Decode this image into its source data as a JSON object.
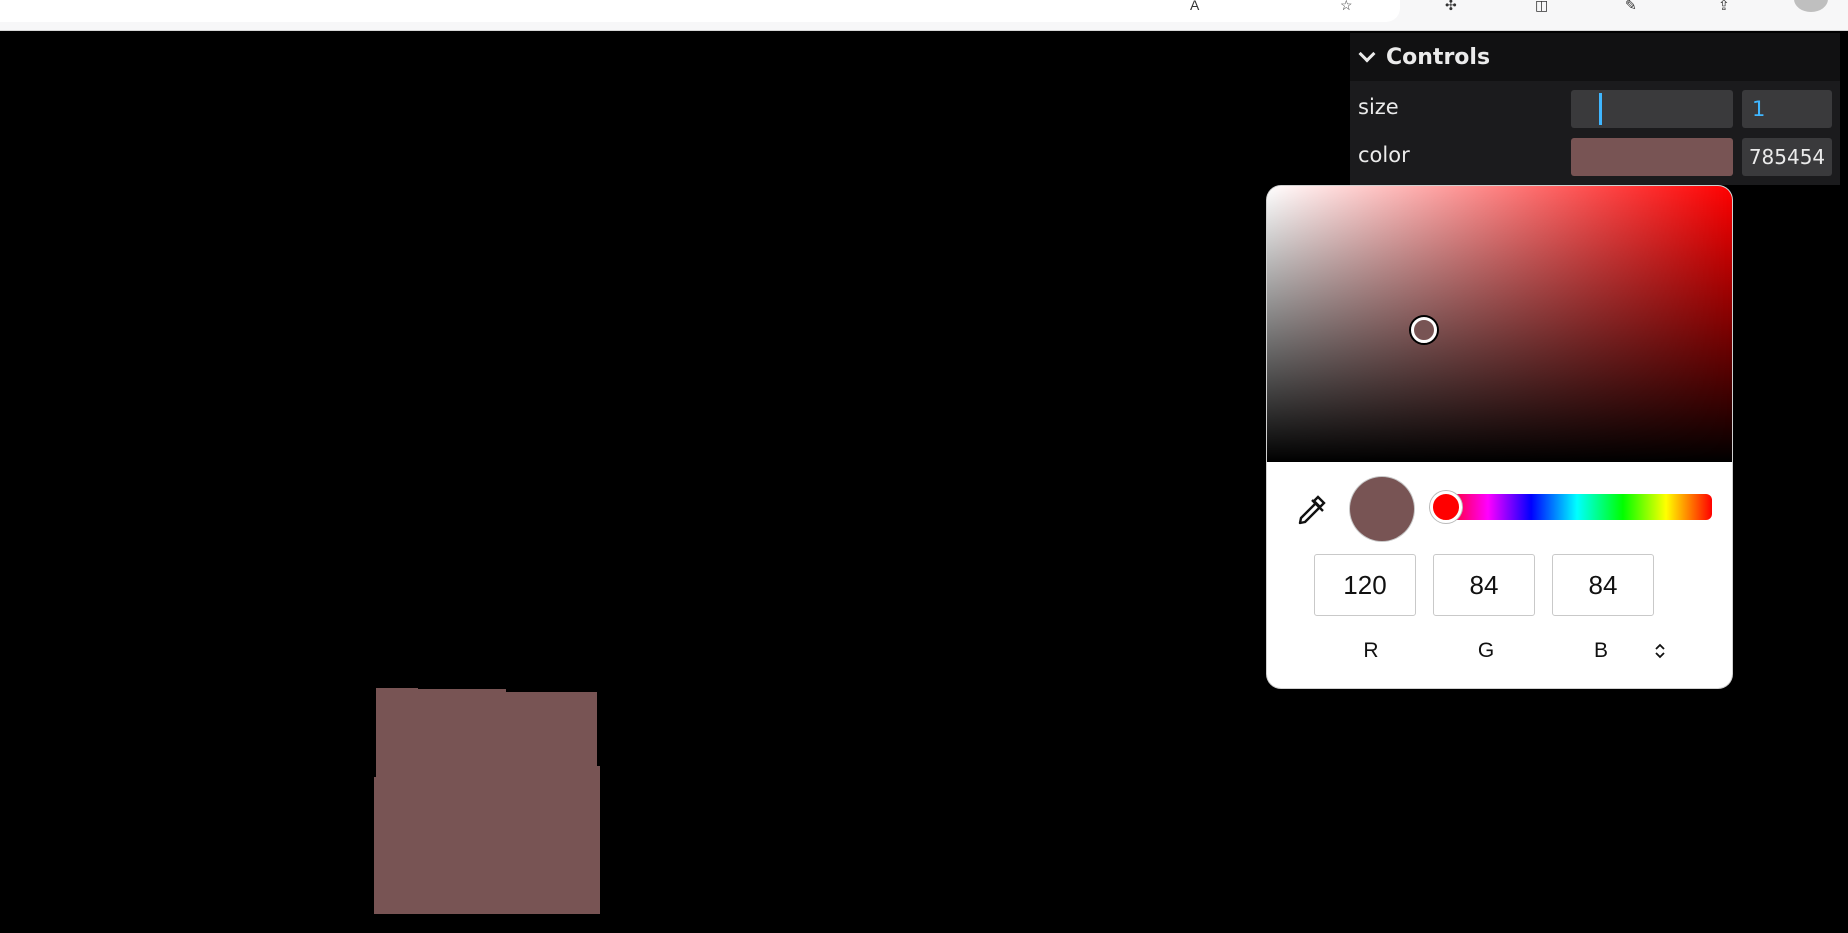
{
  "scene": {
    "box_color": "#785454"
  },
  "controls": {
    "title": "Controls",
    "size": {
      "label": "size",
      "value": "1"
    },
    "color": {
      "label": "color",
      "hex": "785454",
      "swatch": "#785454"
    }
  },
  "picker": {
    "channels": {
      "r": {
        "label": "R",
        "value": "120"
      },
      "g": {
        "label": "G",
        "value": "84"
      },
      "b": {
        "label": "B",
        "value": "84"
      }
    },
    "hue_color": "#ff0000",
    "selected_color": "#785454"
  }
}
